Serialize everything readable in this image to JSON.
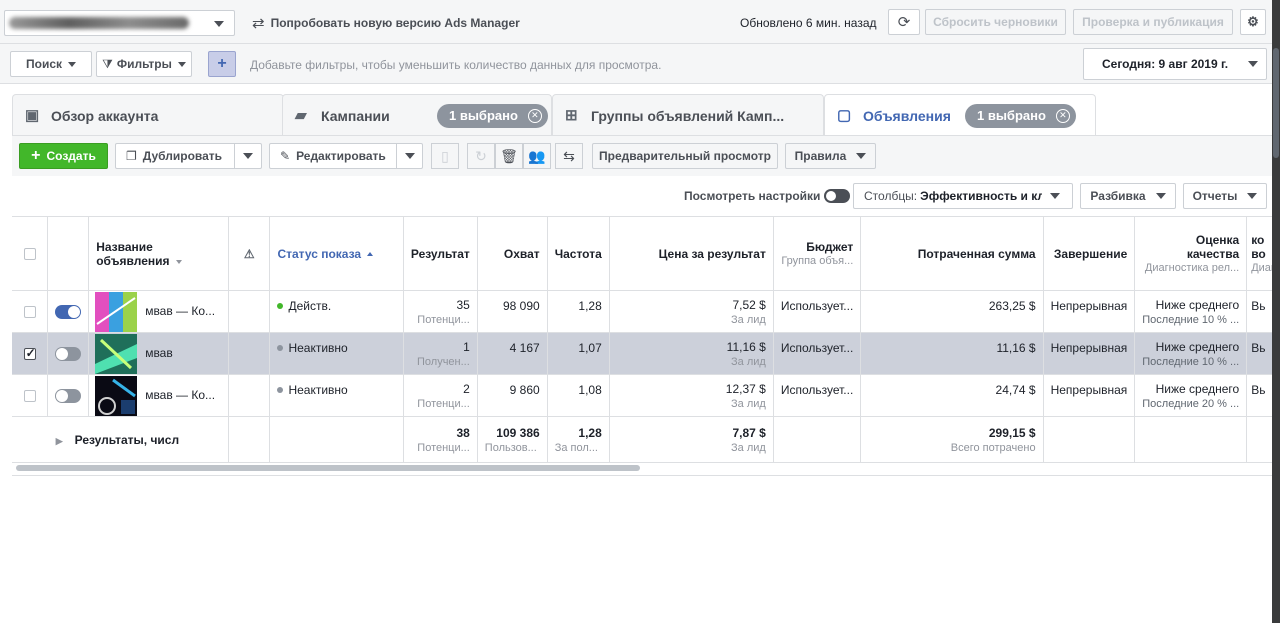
{
  "topbar": {
    "try_new": "Попробовать новую версию Ads Manager",
    "updated": "Обновлено 6 мин. назад",
    "discard": "Сбросить черновики",
    "review_publish": "Проверка и публикация"
  },
  "filterbar": {
    "search": "Поиск",
    "filters": "Фильтры",
    "hint": "Добавьте фильтры, чтобы уменьшить количество данных для просмотра.",
    "date": "Сегодня: 9 авг 2019 г."
  },
  "tabs": [
    {
      "label": "Обзор аккаунта"
    },
    {
      "label": "Кампании",
      "pill": "1 выбрано"
    },
    {
      "label": "Группы объявлений Камп..."
    },
    {
      "label": "Объявления",
      "pill": "1 выбрано"
    }
  ],
  "toolbar": {
    "create": "Создать",
    "duplicate": "Дублировать",
    "edit": "Редактировать",
    "preview": "Предварительный просмотр",
    "rules": "Правила",
    "view_settings": "Посмотреть настройки",
    "columns_prefix": "Столбцы:",
    "columns_value": "Эффективность и кли",
    "breakdown": "Разбивка",
    "reports": "Отчеты"
  },
  "table": {
    "headers": {
      "name": "Название объявления",
      "status": "Статус показа",
      "results": "Результат",
      "reach": "Охват",
      "frequency": "Частота",
      "cost": "Цена за результат",
      "budget": "Бюджет",
      "budget_sub": "Группа объя...",
      "spent": "Потраченная сумма",
      "ends": "Завершение",
      "quality": "Оценка качества",
      "quality_sub": "Диагностика рел...",
      "next": "ко во",
      "next_sub": "Диаг"
    },
    "rows": [
      {
        "name": "мвав — Ко...",
        "status": "Действ.",
        "status_color": "#42b72a",
        "results": "35",
        "results_sub": "Потенци...",
        "reach": "98 090",
        "frequency": "1,28",
        "cost": "7,52 $",
        "cost_sub": "За лид",
        "budget": "Использует...",
        "spent": "263,25 $",
        "ends": "Непрерывная",
        "quality": "Ниже среднего",
        "quality_sub": "Последние 10 % ...",
        "next": "Вь"
      },
      {
        "name": "мвав",
        "status": "Неактивно",
        "status_color": "#8d949e",
        "results": "1",
        "results_sub": "Получен...",
        "reach": "4 167",
        "frequency": "1,07",
        "cost": "11,16 $",
        "cost_sub": "За лид",
        "budget": "Использует...",
        "spent": "11,16 $",
        "ends": "Непрерывная",
        "quality": "Ниже среднего",
        "quality_sub": "Последние 10 % ...",
        "next": "Вь"
      },
      {
        "name": "мвав — Ко...",
        "status": "Неактивно",
        "status_color": "#8d949e",
        "results": "2",
        "results_sub": "Потенци...",
        "reach": "9 860",
        "frequency": "1,08",
        "cost": "12,37 $",
        "cost_sub": "За лид",
        "budget": "Использует...",
        "spent": "24,74 $",
        "ends": "Непрерывная",
        "quality": "Ниже среднего",
        "quality_sub": "Последние 20 % ...",
        "next": "Вь"
      }
    ],
    "total": {
      "label": "Результаты, числ",
      "results": "38",
      "results_sub": "Потенци...",
      "reach": "109 386",
      "reach_sub": "Пользов...",
      "frequency": "1,28",
      "frequency_sub": "За пол...",
      "cost": "7,87 $",
      "cost_sub": "За лид",
      "spent": "299,15 $",
      "spent_sub": "Всего потрачено"
    }
  }
}
